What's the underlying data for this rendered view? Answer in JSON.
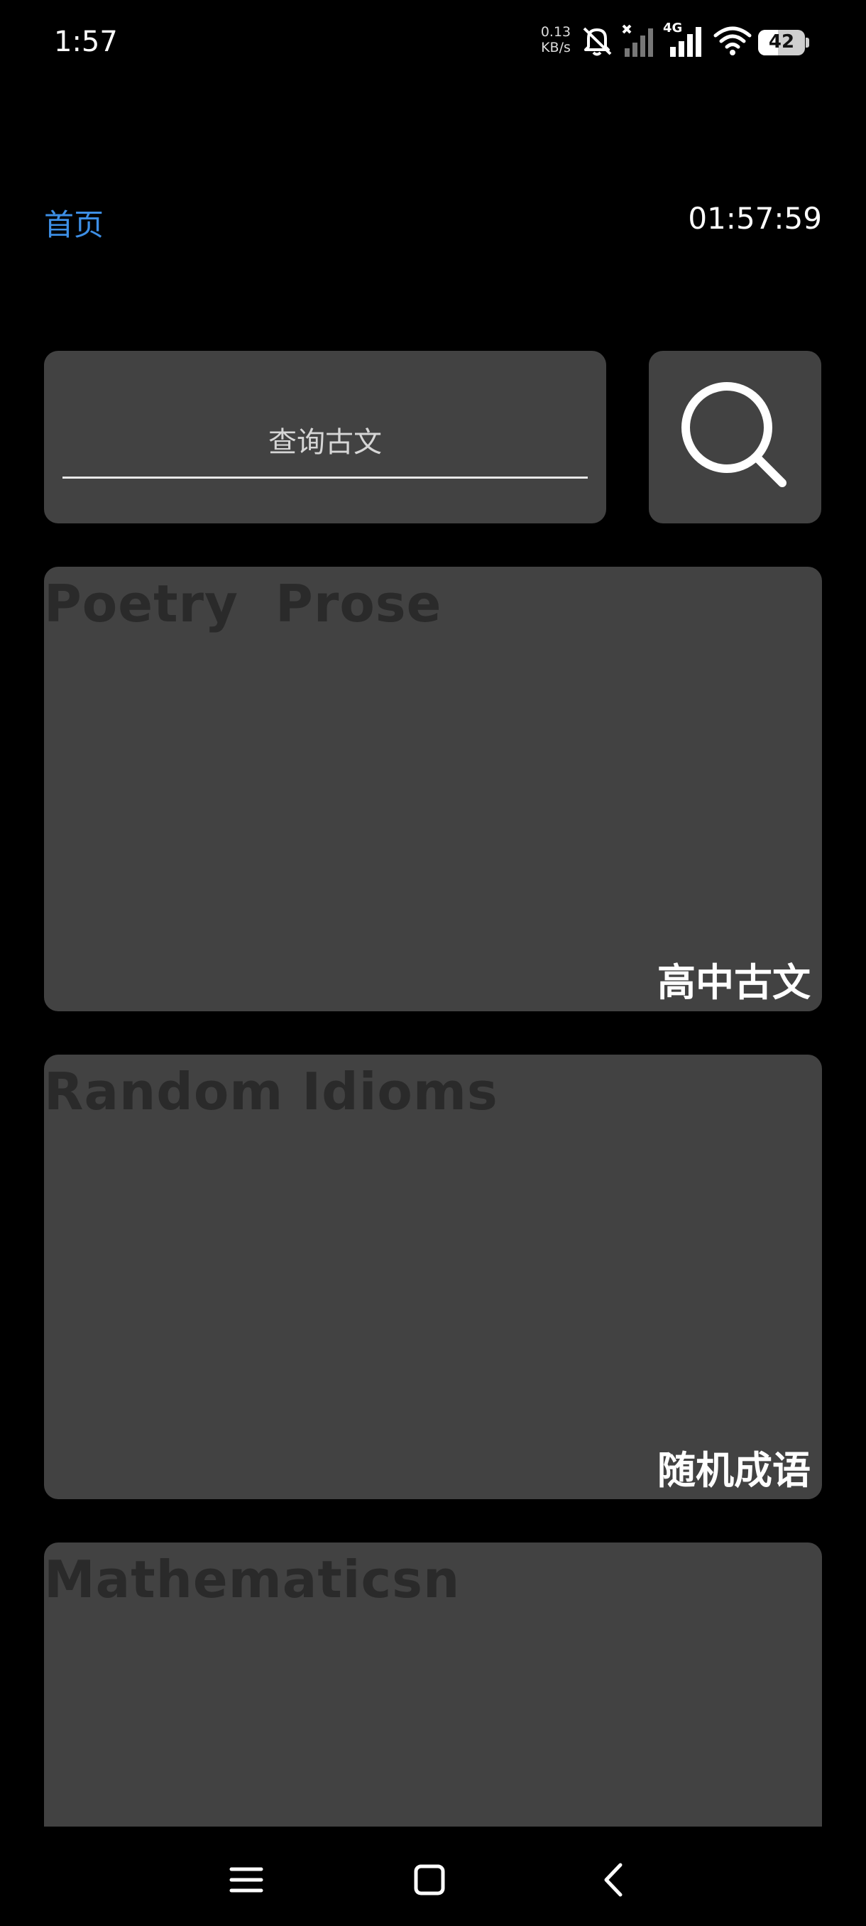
{
  "status_bar": {
    "time": "1:57",
    "net_speed_value": "0.13",
    "net_speed_unit": "KB/s",
    "network_type": "4G",
    "battery_level": "42",
    "icons": [
      "mute-bell-icon",
      "no-signal-icon",
      "signal-icon",
      "wifi-icon",
      "battery-icon"
    ]
  },
  "header": {
    "home_label": "首页",
    "clock": "01:57:59"
  },
  "search": {
    "placeholder": "查询古文",
    "button_icon": "search-icon"
  },
  "cards": [
    {
      "title": "Poetry  Prose",
      "label": "高中古文"
    },
    {
      "title": "Random Idioms",
      "label": "随机成语"
    },
    {
      "title": "Mathematicsn",
      "label": ""
    }
  ],
  "nav_bar": {
    "icons": [
      "menu-icon",
      "home-icon",
      "back-icon"
    ]
  },
  "colors": {
    "background": "#000000",
    "card": "#424242",
    "accent": "#3d8fe6",
    "card_title": "#2a2a2a"
  }
}
